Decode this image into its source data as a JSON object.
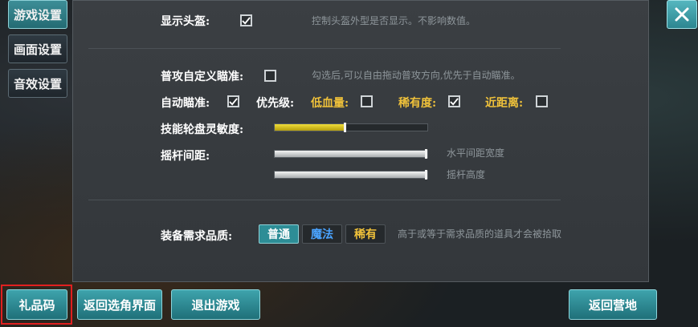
{
  "side_tabs": [
    {
      "label": "游戏设置",
      "active": true
    },
    {
      "label": "画面设置",
      "active": false
    },
    {
      "label": "音效设置",
      "active": false
    }
  ],
  "settings": {
    "helmet": {
      "label": "显示头盔:",
      "checked": true,
      "hint": "控制头盔外型是否显示。不影响数值。"
    },
    "custom_aim": {
      "label": "普攻自定义瞄准:",
      "checked": false,
      "hint": "勾选后,可以自由拖动普攻方向,优先于自动瞄准。"
    },
    "auto_aim": {
      "label": "自动瞄准:",
      "checked": true
    },
    "priority": {
      "label": "优先级:",
      "options": [
        {
          "label": "低血量:",
          "checked": false
        },
        {
          "label": "稀有度:",
          "checked": true
        },
        {
          "label": "近距离:",
          "checked": false
        }
      ]
    },
    "wheel_sensitivity": {
      "label": "技能轮盘灵敏度:",
      "value": 0.47
    },
    "joystick": {
      "label": "摇杆间距:",
      "horizontal": {
        "hint": "水平间距宽度",
        "value": 1.0
      },
      "height": {
        "hint": "摇杆高度",
        "value": 1.0
      }
    },
    "quality": {
      "label": "装备需求品质:",
      "options": [
        {
          "label": "普通",
          "color": "#ffffff",
          "bg": "#2d8d96",
          "selected": true
        },
        {
          "label": "魔法",
          "color": "#4aa3ff",
          "bg": "#25292c",
          "selected": false
        },
        {
          "label": "稀有",
          "color": "#f0c23a",
          "bg": "#25292c",
          "selected": false
        }
      ],
      "hint": "高于或等于需求品质的道具才会被拾取"
    }
  },
  "bottom": {
    "gift_code": "礼品码",
    "back_select": "返回选角界面",
    "exit_game": "退出游戏",
    "back_camp": "返回营地"
  },
  "colors": {
    "accent": "#3ea3ac",
    "slider_yellow": "#d9c21a",
    "highlight": "#e02020"
  }
}
